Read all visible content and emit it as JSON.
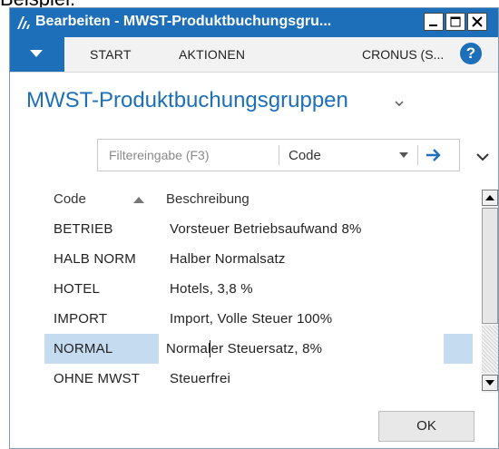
{
  "caption": "Beispiel:",
  "window": {
    "title": "Bearbeiten - MWST-Produktbuchungsgru..."
  },
  "ribbon": {
    "tabs": [
      "START",
      "AKTIONEN"
    ],
    "company": "CRONUS (S...",
    "help": "?"
  },
  "page": {
    "title": "MWST-Produktbuchungsgruppen"
  },
  "filter": {
    "placeholder": "Filtereingabe (F3)",
    "field": "Code"
  },
  "grid": {
    "headers": {
      "code": "Code",
      "description": "Beschreibung"
    },
    "rows": [
      {
        "code": "BETRIEB",
        "description": "Vorsteuer Betriebsaufwand 8%"
      },
      {
        "code": "HALB NORM",
        "description": "Halber Normalsatz"
      },
      {
        "code": "HOTEL",
        "description": "Hotels, 3,8 %"
      },
      {
        "code": "IMPORT",
        "description": "Import, Volle Steuer 100%"
      },
      {
        "code": "NORMAL",
        "description": "Normaler Steuersatz, 8%",
        "selected": true
      },
      {
        "code": "OHNE MWST",
        "description": "Steuerfrei"
      }
    ]
  },
  "footer": {
    "ok_label": "OK"
  },
  "colors": {
    "accent": "#1c6fb8",
    "selection": "#c5dcf0"
  }
}
